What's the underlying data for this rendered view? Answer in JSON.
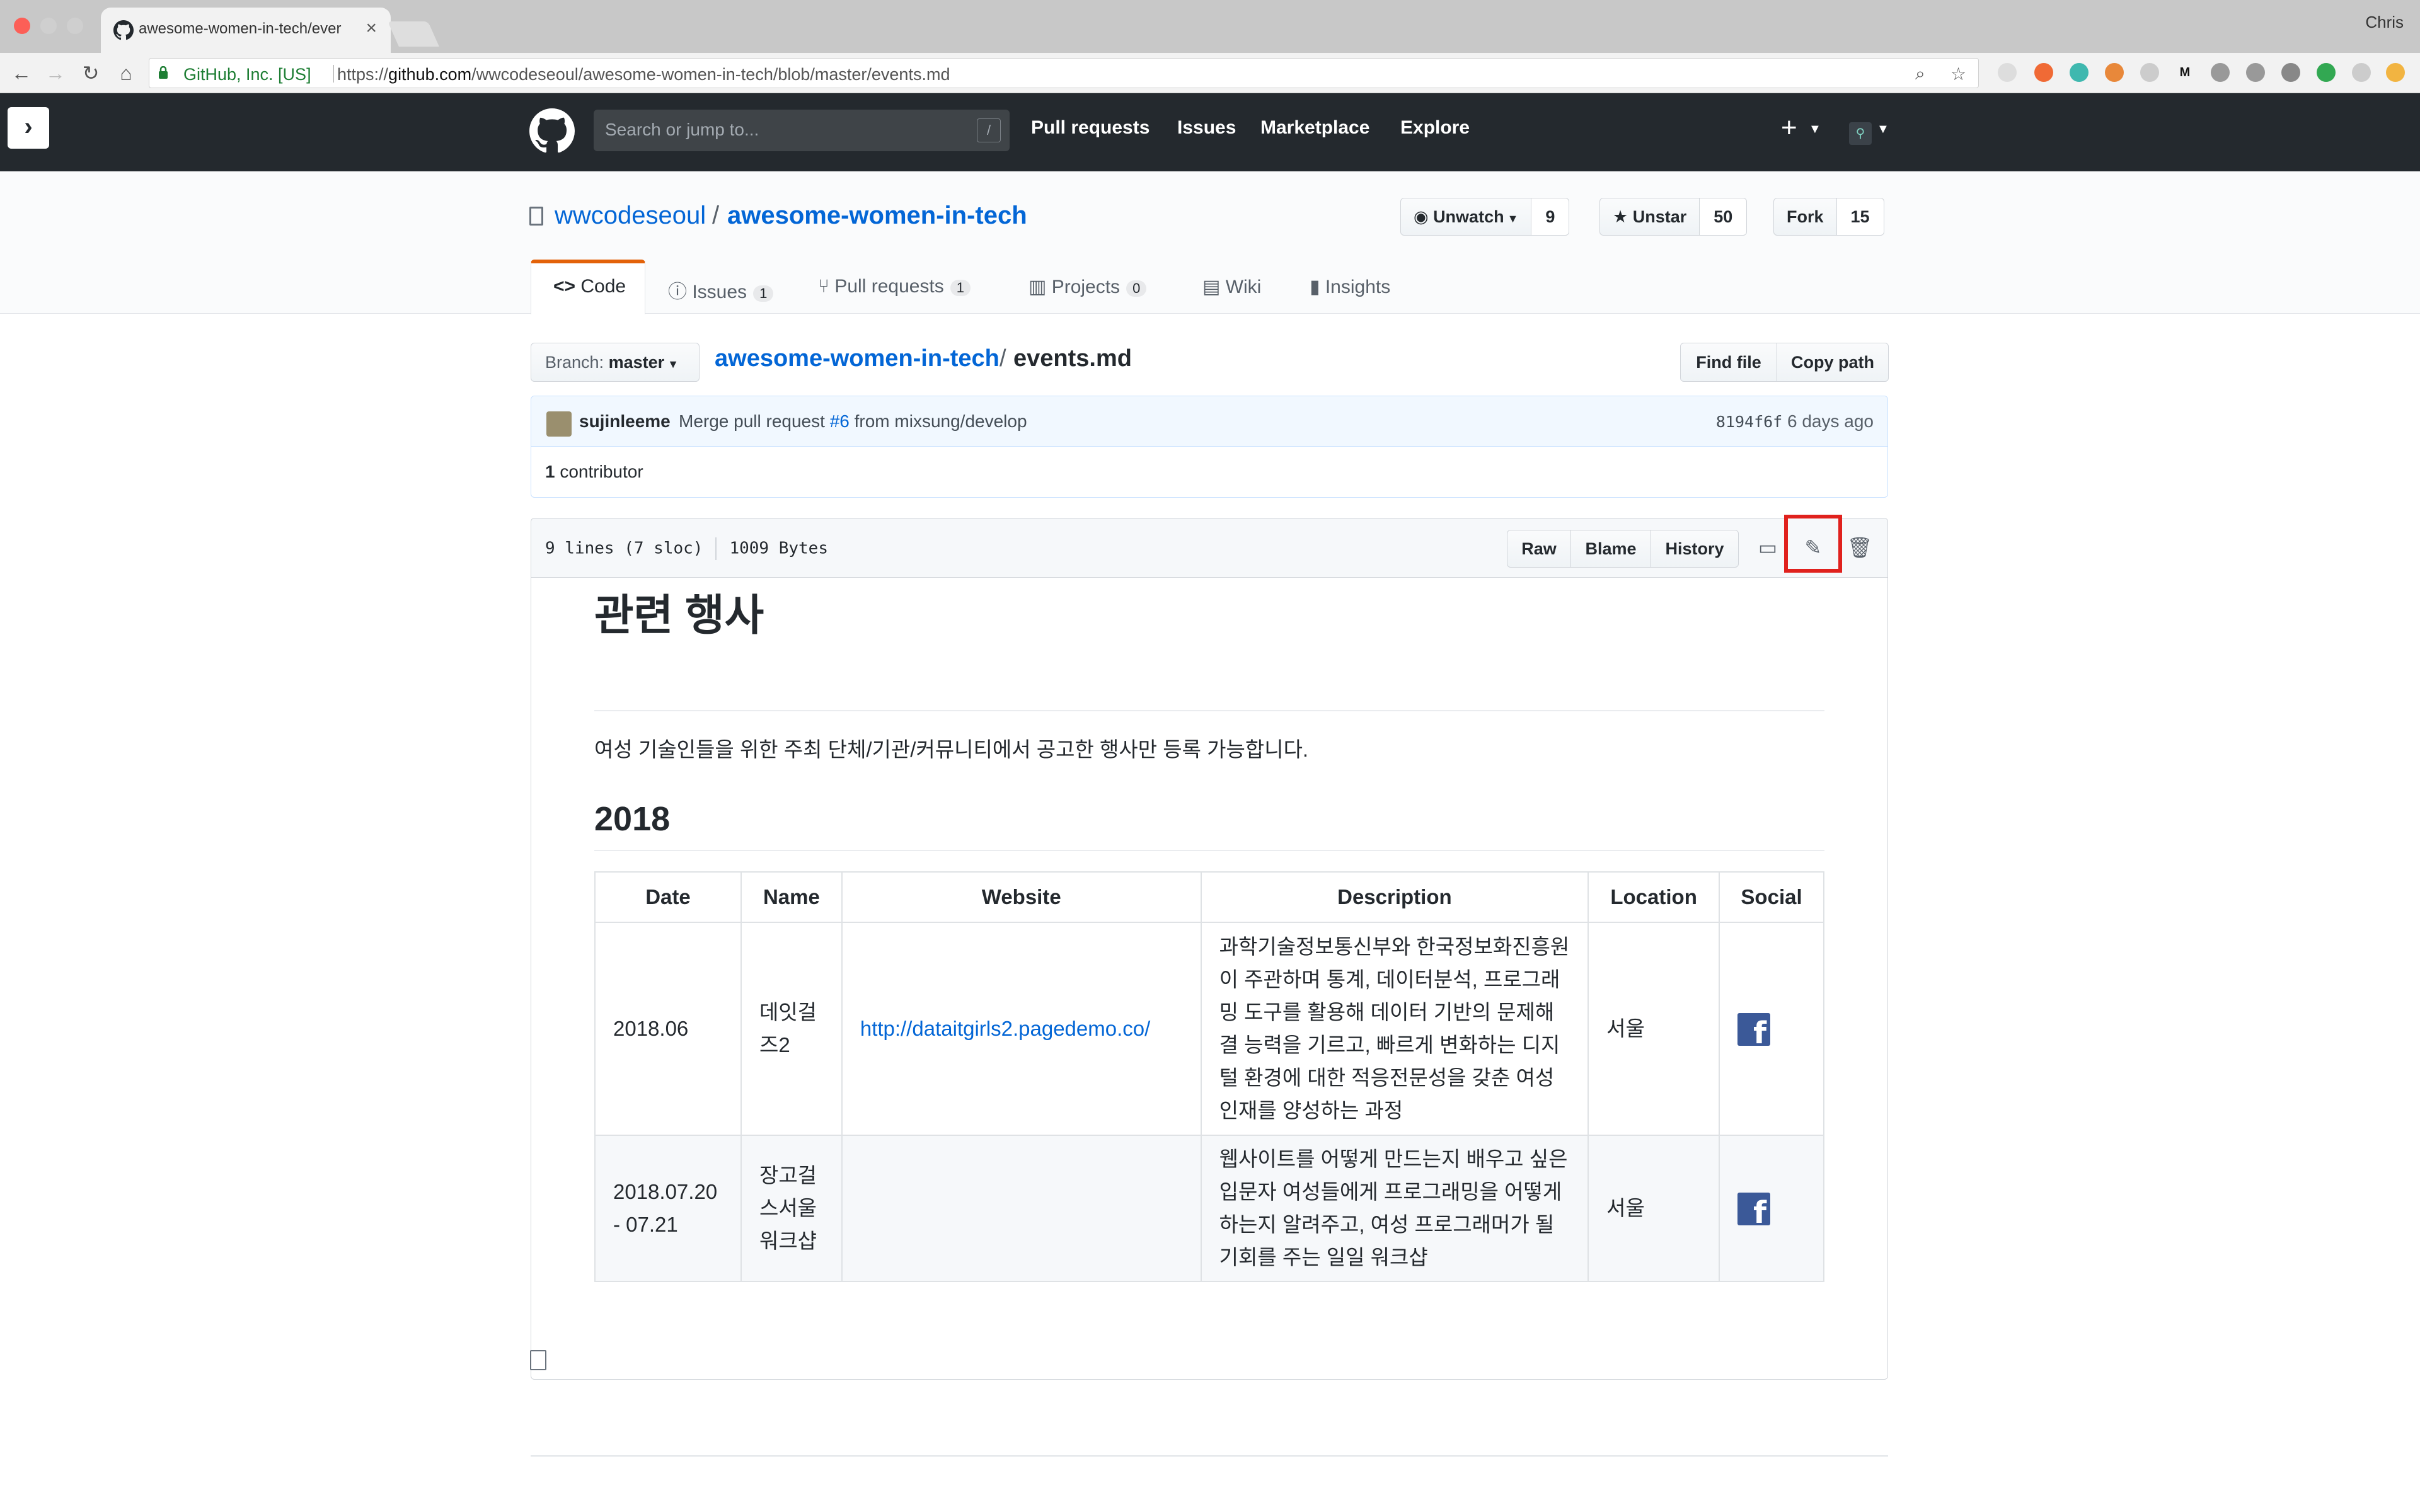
{
  "browser": {
    "tab_title": "awesome-women-in-tech/ever",
    "profile": "Chris",
    "secure_label": "GitHub, Inc. [US]",
    "url_prefix": "https://",
    "url_host": "github.com",
    "url_path": "/wwcodeseoul/awesome-women-in-tech/blob/master/events.md"
  },
  "header": {
    "search_placeholder": "Search or jump to...",
    "slash": "/",
    "nav": [
      "Pull requests",
      "Issues",
      "Marketplace",
      "Explore"
    ],
    "plus": "+"
  },
  "repo": {
    "owner": "wwcodeseoul",
    "separator": "/",
    "name": "awesome-women-in-tech",
    "watch_label": "Unwatch",
    "watch_count": "9",
    "star_label": "Unstar",
    "star_count": "50",
    "fork_label": "Fork",
    "fork_count": "15",
    "tabs": {
      "code": "Code",
      "issues": "Issues",
      "issues_count": "1",
      "pulls": "Pull requests",
      "pulls_count": "1",
      "projects": "Projects",
      "projects_count": "0",
      "wiki": "Wiki",
      "insights": "Insights"
    }
  },
  "filenav": {
    "branch_prefix": "Branch:",
    "branch": "master",
    "repo": "awesome-women-in-tech",
    "sep": "/",
    "file": "events.md",
    "find_file": "Find file",
    "copy_path": "Copy path"
  },
  "commit": {
    "author": "sujinleeme",
    "msg_before": "Merge pull request",
    "pr": "#6",
    "msg_after": "from mixsung/develop",
    "sha": "8194f6f",
    "time": "6 days ago",
    "contrib_count": "1",
    "contrib_label": "contributor"
  },
  "file": {
    "lines": "9 lines (7 sloc)",
    "size": "1009 Bytes",
    "raw": "Raw",
    "blame": "Blame",
    "history": "History"
  },
  "markdown": {
    "h1": "관련 행사",
    "intro": "여성 기술인들을 위한 주최 단체/기관/커뮤니티에서 공고한 행사만 등록 가능합니다.",
    "h2": "2018",
    "table": {
      "headers": [
        "Date",
        "Name",
        "Website",
        "Description",
        "Location",
        "Social"
      ],
      "rows": [
        {
          "date": "2018.06",
          "name": "데잇걸즈2",
          "website": "http://dataitgirls2.pagedemo.co/",
          "description": "과학기술정보통신부와 한국정보화진흥원이 주관하며 통계, 데이터분석, 프로그래밍 도구를 활용해 데이터 기반의 문제해결 능력을 기르고, 빠르게 변화하는 디지털 환경에 대한 적응전문성을 갖춘 여성인재를 양성하는 과정",
          "location": "서울",
          "social": "f"
        },
        {
          "date": "2018.07.20 - 07.21",
          "name": "장고걸스서울 워크샵",
          "website": "",
          "description": "웹사이트를 어떻게 만드는지 배우고 싶은 입문자 여성들에게 프로그래밍을 어떻게 하는지 알려주고, 여성 프로그래머가 될 기회를 주는 일일 워크샵",
          "location": "서울",
          "social": "f"
        }
      ]
    }
  },
  "colors": {
    "link": "#0366d6",
    "header_bg": "#24292e",
    "highlight": "#e0211d",
    "facebook": "#3b5998"
  },
  "icons": [
    "github-favicon",
    "lock-icon",
    "github-logo-icon",
    "eye-icon",
    "star-icon",
    "fork-icon",
    "repo-icon",
    "code-icon",
    "issue-icon",
    "pull-request-icon",
    "project-icon",
    "wiki-icon",
    "graph-icon",
    "desktop-icon",
    "pencil-icon",
    "trash-icon",
    "facebook-icon",
    "file-icon"
  ]
}
